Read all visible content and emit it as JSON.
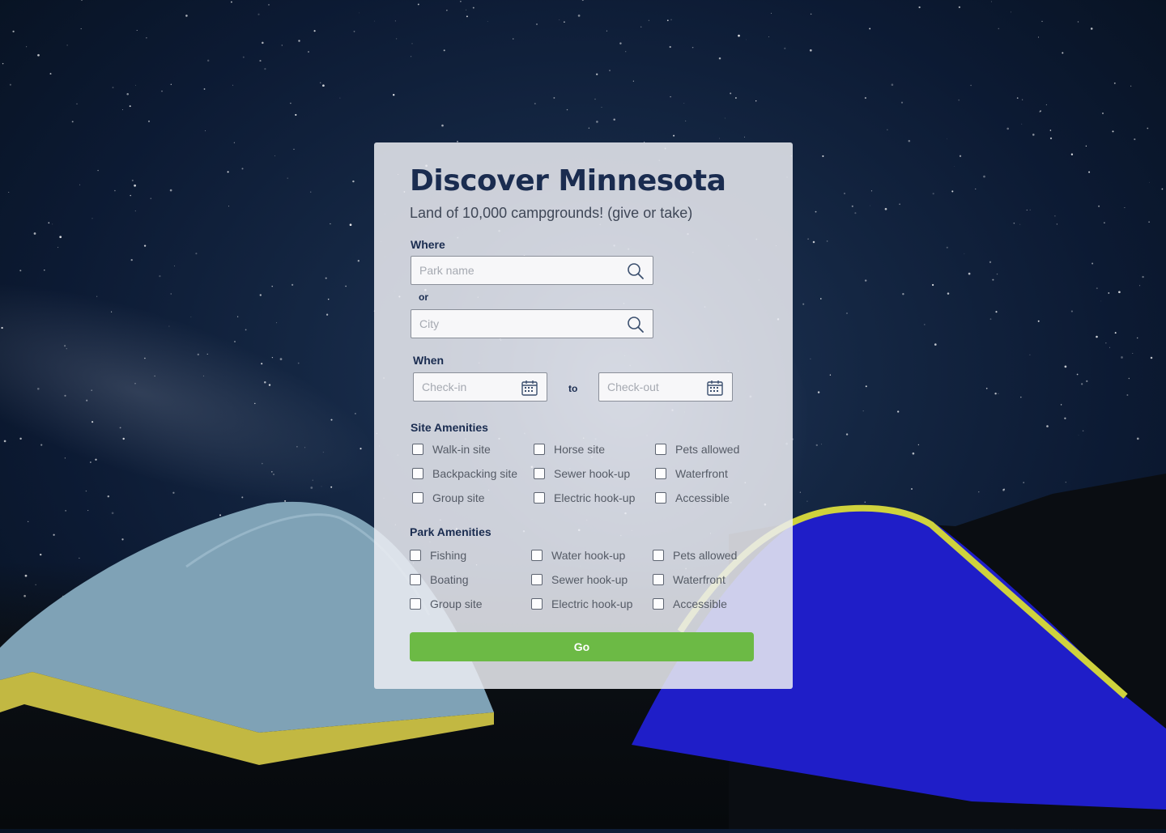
{
  "header": {
    "title": "Discover Minnesota",
    "subtitle": "Land of 10,000 campgrounds! (give or take)"
  },
  "where": {
    "label": "Where",
    "park_placeholder": "Park name",
    "or_label": "or",
    "city_placeholder": "City",
    "search_icon": "search-icon"
  },
  "when": {
    "label": "When",
    "checkin_placeholder": "Check-in",
    "to_label": "to",
    "checkout_placeholder": "Check-out",
    "calendar_icon": "calendar-icon"
  },
  "site_amenities": {
    "label": "Site Amenities",
    "items": [
      "Walk-in site",
      "Horse site",
      "Pets allowed",
      "Backpacking site",
      "Sewer hook-up",
      "Waterfront",
      "Group site",
      "Electric hook-up",
      "Accessible"
    ]
  },
  "park_amenities": {
    "label": "Park Amenities",
    "items": [
      "Fishing",
      "Water hook-up",
      "Pets allowed",
      "Boating",
      "Sewer hook-up",
      "Waterfront",
      "Group site",
      "Electric hook-up",
      "Accessible"
    ]
  },
  "actions": {
    "go_label": "Go"
  },
  "colors": {
    "accent": "#6cba45",
    "heading": "#1a2c50"
  }
}
